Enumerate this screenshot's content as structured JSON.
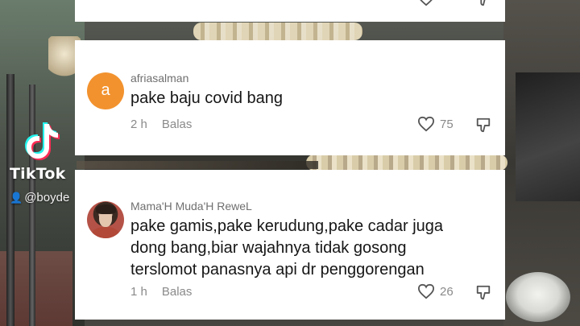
{
  "watermark": {
    "brand": "TikTok",
    "handle": "@boyde"
  },
  "comments": [
    {
      "username": "afriasalman",
      "avatar_letter": "a",
      "avatar_color": "#f2922e",
      "text_lines": [
        "pake baju covid bang"
      ],
      "time": "2 h",
      "reply_label": "Balas",
      "likes": "75"
    },
    {
      "username": "Mama'H Muda'H ReweL",
      "avatar_icon": "profile-photo",
      "text_lines": [
        "pake gamis,pake kerudung,pake cadar juga",
        "dong bang,biar wajahnya tidak gosong",
        "terslomot panasnya api dr penggorengan"
      ],
      "time": "1 h",
      "reply_label": "Balas",
      "likes": "26"
    }
  ]
}
